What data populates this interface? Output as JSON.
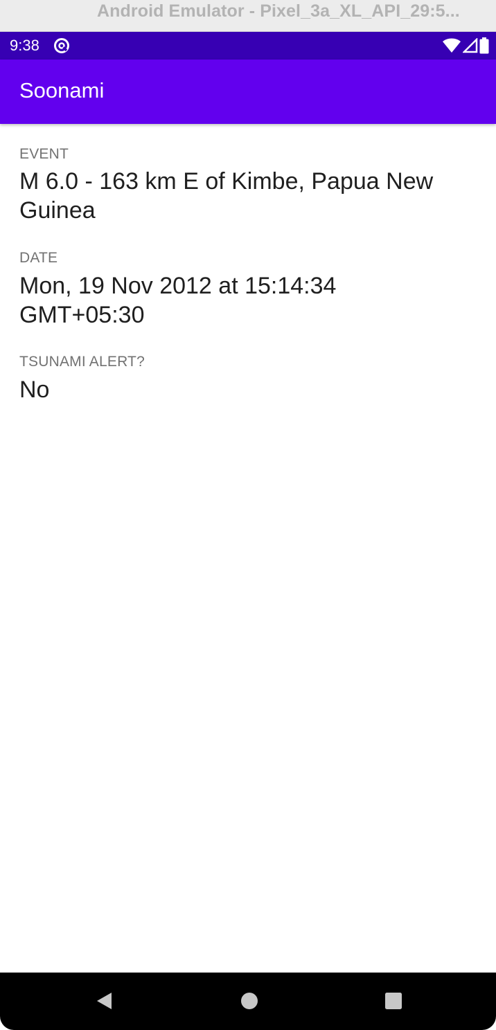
{
  "window": {
    "title": "Android Emulator - Pixel_3a_XL_API_29:5..."
  },
  "status_bar": {
    "time": "9:38",
    "left_icon": "data-saver-icon",
    "right_icons": [
      "wifi-icon",
      "cell-signal-icon",
      "battery-icon"
    ],
    "color": "#3700b3"
  },
  "app_bar": {
    "title": "Soonami",
    "color": "#6200ee"
  },
  "fields": {
    "event": {
      "label": "EVENT",
      "value": "M 6.0 - 163 km E of Kimbe, Papua New Guinea"
    },
    "date": {
      "label": "DATE",
      "value": "Mon, 19 Nov 2012 at 15:14:34 GMT+05:30"
    },
    "tsunami_alert": {
      "label": "TSUNAMI ALERT?",
      "value": "No"
    }
  },
  "nav_bar": {
    "buttons": [
      "back-icon",
      "home-icon",
      "recents-icon"
    ]
  }
}
